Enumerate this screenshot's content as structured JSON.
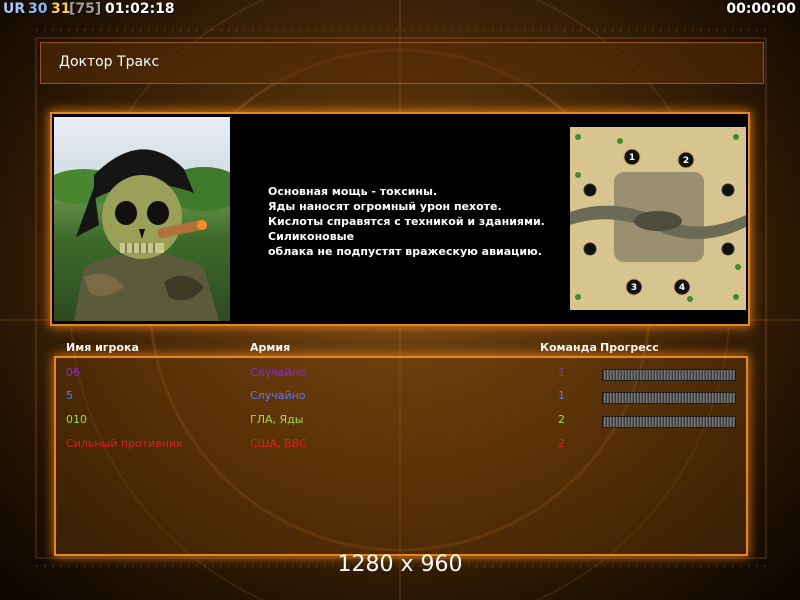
{
  "hud": {
    "ur": "UR",
    "value_a": "30",
    "value_b": "31",
    "value_c": "[75]",
    "clock": "01:02:18",
    "timer": "00:00:00"
  },
  "general": {
    "name": "Доктор Тракс",
    "description": [
      "Основная мощь - токсины.",
      "Яды наносят огромный урон пехоте.",
      "Кислоты справятся с техникой и зданиями.",
      "Силиконовые",
      "облака не подпустят вражескую авиацию."
    ]
  },
  "minimap": {
    "start_positions": [
      "1",
      "2",
      "3",
      "4"
    ]
  },
  "player_list": {
    "headers": {
      "player": "Имя игрока",
      "army": "Армия",
      "team": "Команда",
      "progress": "Прогресс"
    },
    "rows": [
      {
        "name": "06",
        "army": "Случайно",
        "team": "1",
        "color": "#8c2bd6"
      },
      {
        "name": "5",
        "army": "Случайно",
        "team": "1",
        "color": "#5b76ff"
      },
      {
        "name": "010",
        "army": "ГЛА, Яды",
        "team": "2",
        "color": "#9ee03a"
      },
      {
        "name": "Сильный противник",
        "army": "США, ВВС",
        "team": "2",
        "color": "#e0201c"
      }
    ]
  },
  "resolution": "1280 x 960"
}
